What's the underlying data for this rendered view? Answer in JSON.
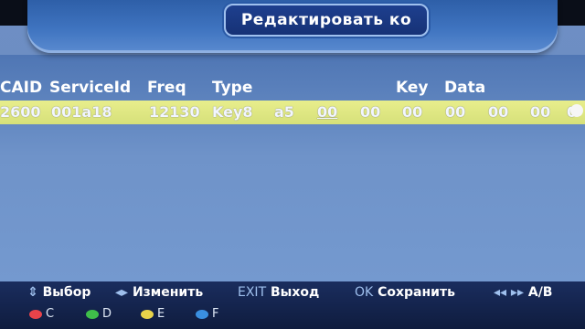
{
  "window": {
    "title": "Редактировать ко"
  },
  "table": {
    "headers": [
      "CAID",
      "ServiceId",
      "Freq",
      "Type",
      "Key",
      "Data"
    ],
    "row": {
      "caid": "2600",
      "service_id": "001a18",
      "freq": "12130",
      "type": "Key8",
      "index": "a5",
      "key_bytes": [
        "00",
        "00",
        "00",
        "00",
        "00",
        "00",
        "00"
      ]
    }
  },
  "help": {
    "select_label": "Выбор",
    "edit_label": "Изменить",
    "exit_key": "EXIT",
    "exit_label": "Выход",
    "ok_key": "OK",
    "ok_label": "Сохранить",
    "ab_label": "A/B"
  },
  "color_buttons": [
    {
      "label": "C",
      "color": "#e8434a"
    },
    {
      "label": "D",
      "color": "#3fbf4a"
    },
    {
      "label": "E",
      "color": "#e8d34a"
    },
    {
      "label": "F",
      "color": "#3a8fe0"
    }
  ],
  "colors": {
    "selection": "#dbe37e",
    "background": "#6f93c9",
    "title_box": "#1e3f8e"
  }
}
